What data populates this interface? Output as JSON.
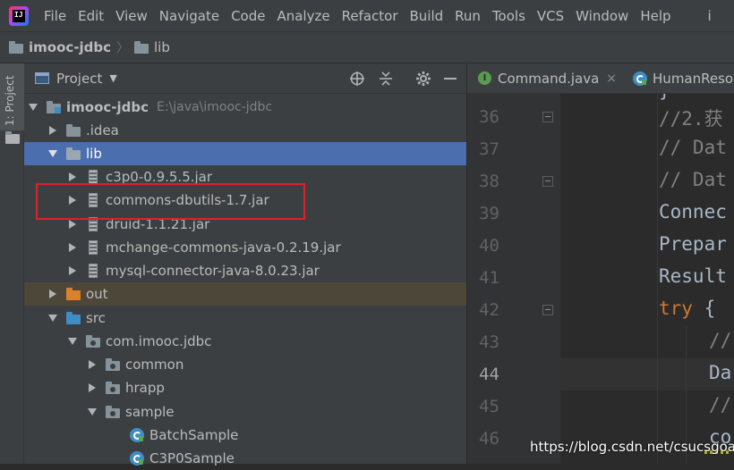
{
  "menubar": {
    "logo_text": "IJ",
    "items": [
      "File",
      "Edit",
      "View",
      "Navigate",
      "Code",
      "Analyze",
      "Refactor",
      "Build",
      "Run",
      "Tools",
      "VCS",
      "Window",
      "Help"
    ],
    "overflow": "i"
  },
  "breadcrumb": {
    "project": "imooc-jdbc",
    "folder": "lib"
  },
  "tool_strip": {
    "label": "1: Project"
  },
  "project_panel": {
    "title": "Project",
    "tree": [
      {
        "label": "imooc-jdbc",
        "hint": "E:\\java\\imooc-jdbc",
        "type": "module",
        "expanded": true
      },
      {
        "label": ".idea",
        "type": "folder",
        "expanded": false
      },
      {
        "label": "lib",
        "type": "folder",
        "expanded": true,
        "selected": true
      },
      {
        "label": "c3p0-0.9.5.5.jar",
        "type": "jar"
      },
      {
        "label": "commons-dbutils-1.7.jar",
        "type": "jar",
        "highlighted": true
      },
      {
        "label": "druid-1.1.21.jar",
        "type": "jar"
      },
      {
        "label": "mchange-commons-java-0.2.19.jar",
        "type": "jar"
      },
      {
        "label": "mysql-connector-java-8.0.23.jar",
        "type": "jar"
      },
      {
        "label": "out",
        "type": "folder-excluded",
        "expanded": false
      },
      {
        "label": "src",
        "type": "source-folder",
        "expanded": true
      },
      {
        "label": "com.imooc.jdbc",
        "type": "package",
        "expanded": true
      },
      {
        "label": "common",
        "type": "package",
        "expanded": false
      },
      {
        "label": "hrapp",
        "type": "package",
        "expanded": false
      },
      {
        "label": "sample",
        "type": "package",
        "expanded": true
      },
      {
        "label": "BatchSample",
        "type": "class"
      },
      {
        "label": "C3P0Sample",
        "type": "class"
      }
    ]
  },
  "editor": {
    "tabs": [
      {
        "name": "Command.java",
        "close": "×"
      },
      {
        "name": "HumanResou",
        "close": ""
      }
    ],
    "line_numbers": [
      "36",
      "37",
      "38",
      "39",
      "40",
      "41",
      "42",
      "43",
      "44",
      "45",
      "46"
    ],
    "current_line": "44",
    "lines": [
      {
        "text": "}",
        "kind": "plain"
      },
      {
        "text": "//2.获",
        "kind": "cmt"
      },
      {
        "text": "// Dat",
        "kind": "cmt"
      },
      {
        "text": "// Dat",
        "kind": "cmt"
      },
      {
        "text": "Connec",
        "kind": "plain"
      },
      {
        "text": "Prepar",
        "kind": "plain"
      },
      {
        "text": "Result",
        "kind": "plain"
      },
      {
        "text": "try",
        "kind": "kw",
        "rest": " {"
      },
      {
        "text": "//",
        "kind": "cmt"
      },
      {
        "text": "Da",
        "kind": "plain"
      },
      {
        "text": "//",
        "kind": "cmt"
      },
      {
        "text": "co",
        "kind": "plain"
      }
    ]
  },
  "watermark": "https://blog.csdn.net/csucsgoat",
  "colors": {
    "selection": "#4b6eaf",
    "excluded_row": "#4d473a",
    "annotation_box": "#e0202a",
    "keyword": "#cc7832",
    "comment": "#808080"
  }
}
